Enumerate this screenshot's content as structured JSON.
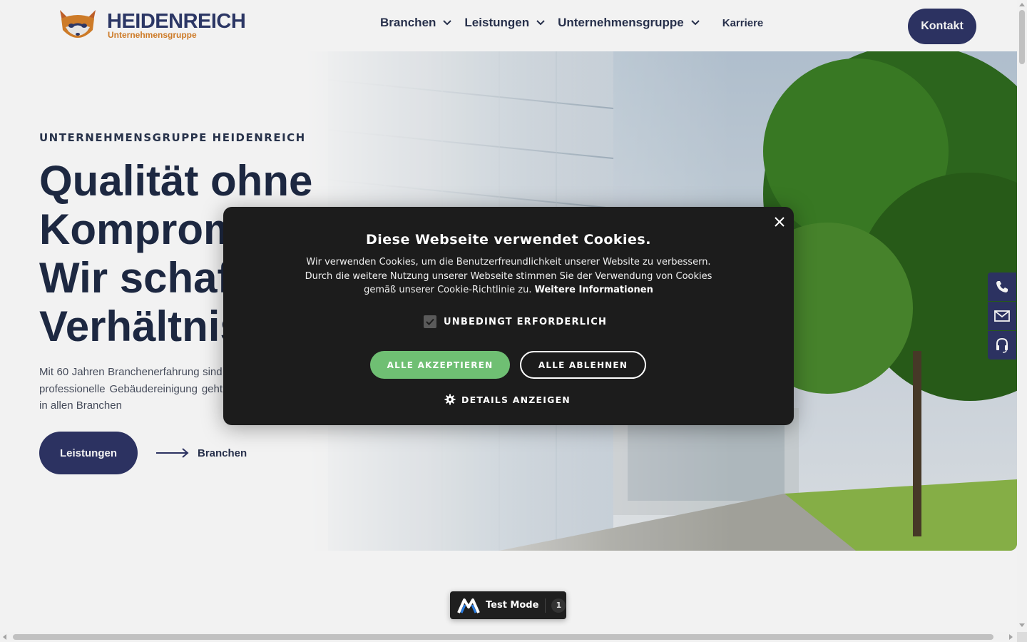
{
  "header": {
    "logo": {
      "name": "HEIDENREICH",
      "sub": "Unternehmensgruppe"
    },
    "nav": [
      {
        "label": "Branchen",
        "has_dropdown": true
      },
      {
        "label": "Leistungen",
        "has_dropdown": true
      },
      {
        "label": "Unternehmensgruppe",
        "has_dropdown": true
      },
      {
        "label": "Karriere",
        "has_dropdown": false
      }
    ],
    "contact_button": "Kontakt"
  },
  "hero": {
    "eyebrow": "UNTERNEHMENSGRUPPE HEIDENREICH",
    "headline": "Qualität ohne Kompromisse – Wir schaffen Verhältnisse",
    "intro": "Mit 60 Jahren Branchenerfahrung sind wir Ihr Partner, wenn es um die professionelle Gebäudereinigung geht – maßgeschneidert sorgen wir in allen Branchen",
    "primary_button": "Leistungen",
    "secondary_link": "Branchen"
  },
  "sidebar": {
    "icons": [
      "phone-icon",
      "mail-icon",
      "headset-icon"
    ]
  },
  "cookie_modal": {
    "title": "Diese Webseite verwendet Cookies.",
    "text": "Wir verwenden Cookies, um die Benutzerfreundlichkeit unserer Website zu verbessern. Durch die weitere Nutzung unserer Webseite stimmen Sie der Verwendung von Cookies gemäß unserer Cookie-Richtlinie zu.",
    "more_info_link": "Weitere Informationen",
    "checkbox_label": "UNBEDINGT ERFORDERLICH",
    "checkbox_checked": true,
    "accept_button": "ALLE AKZEPTIEREN",
    "reject_button": "ALLE ABLEHNEN",
    "details_link": "DETAILS ANZEIGEN"
  },
  "test_mode": {
    "label": "Test Mode",
    "count": "1"
  },
  "colors": {
    "brand_navy": "#2f3567",
    "brand_orange": "#d9822b",
    "accept_green": "#6fbf73",
    "modal_bg": "#1c1c1c"
  }
}
